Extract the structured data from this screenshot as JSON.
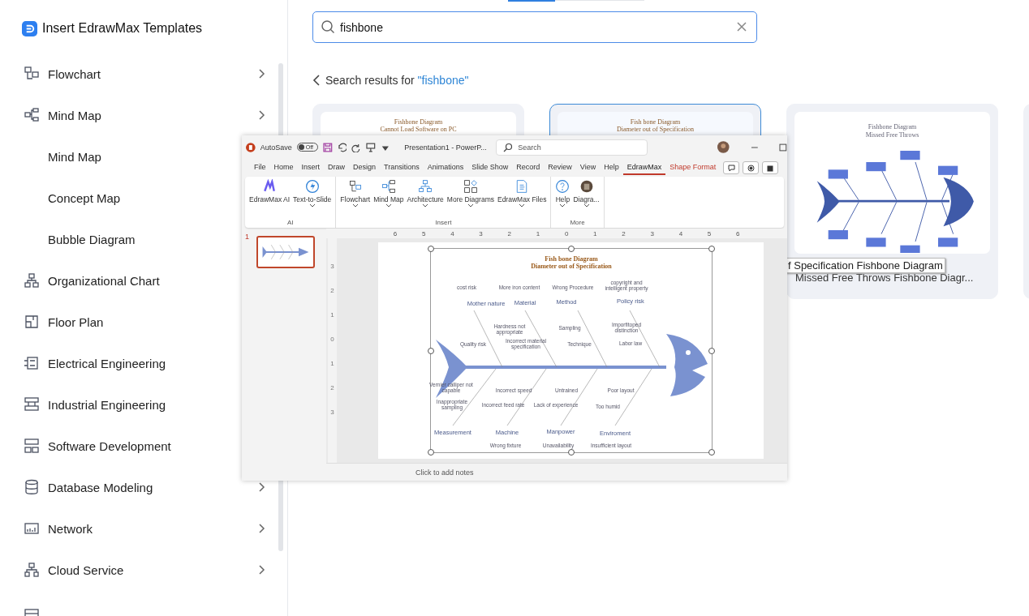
{
  "sidebar": {
    "title": "Insert EdrawMax Templates",
    "items": [
      {
        "label": "Flowchart",
        "arrow": true
      },
      {
        "label": "Mind Map",
        "arrow": true,
        "children": [
          {
            "label": "Mind Map"
          },
          {
            "label": "Concept Map"
          },
          {
            "label": "Bubble Diagram"
          }
        ]
      },
      {
        "label": "Organizational Chart",
        "arrow": false
      },
      {
        "label": "Floor Plan",
        "arrow": false
      },
      {
        "label": "Electrical Engineering",
        "arrow": false
      },
      {
        "label": "Industrial Engineering",
        "arrow": false
      },
      {
        "label": "Software Development",
        "arrow": false
      },
      {
        "label": "Database Modeling",
        "arrow": true
      },
      {
        "label": "Network",
        "arrow": true
      },
      {
        "label": "Cloud Service",
        "arrow": true
      }
    ]
  },
  "search": {
    "value": "fishbone"
  },
  "results_header": {
    "label": "Search results for ",
    "query": "\"fishbone\""
  },
  "cards": [
    {
      "thumb_title": [
        "Fishbone Diagram",
        "Cannot Load Software on PC"
      ],
      "selected": false
    },
    {
      "thumb_title": [
        "Fish bone Diagram",
        "Diameter out of Specification"
      ],
      "selected": true
    },
    {
      "thumb_title": [
        "Fishbone Diagram",
        "Missed Free Throws"
      ],
      "selected": false,
      "title": "Missed Free Throws Fishbone Diagr..."
    }
  ],
  "tooltip": "f Specification Fishbone Diagram",
  "ppt": {
    "autosave_label": "AutoSave",
    "autosave_state": "Off",
    "doc_title": "Presentation1  -  PowerP...",
    "search_placeholder": "Search",
    "menu": [
      {
        "label": "File",
        "selected": false,
        "kind": "tab"
      },
      {
        "label": "Home",
        "selected": false,
        "kind": "tab"
      },
      {
        "label": "Insert",
        "selected": false,
        "kind": "tab"
      },
      {
        "label": "Draw",
        "selected": false,
        "kind": "tab"
      },
      {
        "label": "Design",
        "selected": false,
        "kind": "tab"
      },
      {
        "label": "Transitions",
        "selected": false,
        "kind": "tab"
      },
      {
        "label": "Animations",
        "selected": false,
        "kind": "tab"
      },
      {
        "label": "Slide Show",
        "selected": false,
        "kind": "tab"
      },
      {
        "label": "Record",
        "selected": false,
        "kind": "tab"
      },
      {
        "label": "Review",
        "selected": false,
        "kind": "tab"
      },
      {
        "label": "View",
        "selected": false,
        "kind": "tab"
      },
      {
        "label": "Help",
        "selected": false,
        "kind": "tab"
      },
      {
        "label": "EdrawMax",
        "selected": true,
        "kind": "tab"
      },
      {
        "label": "Shape Format",
        "selected": false,
        "kind": "context"
      }
    ],
    "groups": [
      {
        "label": "AI",
        "buttons": [
          {
            "label": "EdrawMax AI",
            "dropdown": false
          },
          {
            "label": "Text-to-Slide",
            "dropdown": true
          }
        ]
      },
      {
        "label": "Insert",
        "buttons": [
          {
            "label": "Flowchart",
            "dropdown": true
          },
          {
            "label": "Mind Map",
            "dropdown": true
          },
          {
            "label": "Architecture",
            "dropdown": true
          },
          {
            "label": "More Diagrams",
            "dropdown": true
          },
          {
            "label": "EdrawMax Files",
            "dropdown": true
          }
        ]
      },
      {
        "label": "More",
        "buttons": [
          {
            "label": "Help",
            "dropdown": true
          },
          {
            "label": "Diagra...",
            "dropdown": true
          }
        ]
      }
    ],
    "slide_number": "1",
    "ruler_h": [
      "6",
      "5",
      "4",
      "3",
      "2",
      "1",
      "0",
      "1",
      "2",
      "3",
      "4",
      "5",
      "6"
    ],
    "ruler_v": [
      "3",
      "2",
      "1",
      "0",
      "1",
      "2",
      "3"
    ],
    "slide": {
      "title": [
        "Fish bone Diagram",
        "Diameter out of Specification"
      ],
      "labels": [
        {
          "text": "cost risk",
          "kind": "cause"
        },
        {
          "text": "More iron content",
          "kind": "cause"
        },
        {
          "text": "Wrong Procedure",
          "kind": "cause"
        },
        {
          "text": "copyright and intelligent property",
          "kind": "cause"
        },
        {
          "text": "Mother nature",
          "kind": "category"
        },
        {
          "text": "Material",
          "kind": "category"
        },
        {
          "text": "Method",
          "kind": "category"
        },
        {
          "text": "Policy risk",
          "kind": "category"
        },
        {
          "text": "Hardness not appropriate",
          "kind": "cause"
        },
        {
          "text": "Sampling",
          "kind": "cause"
        },
        {
          "text": "Imporfitoped distinction",
          "kind": "cause"
        },
        {
          "text": "Quality risk",
          "kind": "cause"
        },
        {
          "text": "Incorrect material specification",
          "kind": "cause"
        },
        {
          "text": "Technique",
          "kind": "cause"
        },
        {
          "text": "Labor law",
          "kind": "cause"
        },
        {
          "text": "Vernier calliper not capable",
          "kind": "cause"
        },
        {
          "text": "Incorrect speed",
          "kind": "cause"
        },
        {
          "text": "Untrained",
          "kind": "cause"
        },
        {
          "text": "Poor layout",
          "kind": "cause"
        },
        {
          "text": "Inappropriate sampling",
          "kind": "cause"
        },
        {
          "text": "Incorrect feed rate",
          "kind": "cause"
        },
        {
          "text": "Lack of experience",
          "kind": "cause"
        },
        {
          "text": "Too humid",
          "kind": "cause"
        },
        {
          "text": "Measurement",
          "kind": "category"
        },
        {
          "text": "Machine",
          "kind": "category"
        },
        {
          "text": "Manpower",
          "kind": "category"
        },
        {
          "text": "Enviroment",
          "kind": "category"
        },
        {
          "text": "Wrong fixture",
          "kind": "cause"
        },
        {
          "text": "Unavailability",
          "kind": "cause"
        },
        {
          "text": "Insufficient layout",
          "kind": "cause"
        }
      ]
    },
    "notes_placeholder": "Click to add notes"
  }
}
